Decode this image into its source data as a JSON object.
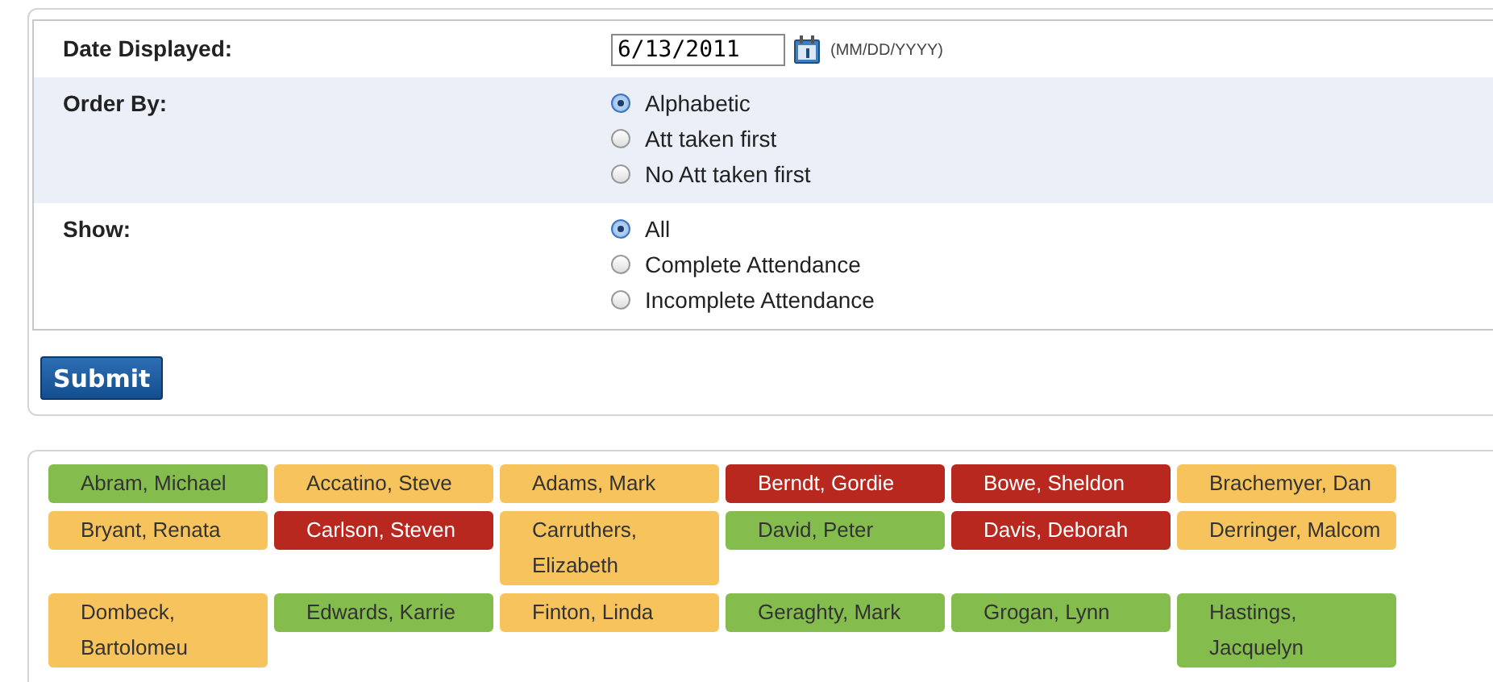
{
  "filters": {
    "date": {
      "label": "Date Displayed:",
      "value": "6/13/2011",
      "format_hint": "(MM/DD/YYYY)"
    },
    "order_by": {
      "label": "Order By:",
      "options": [
        {
          "label": "Alphabetic",
          "selected": true
        },
        {
          "label": "Att taken first",
          "selected": false
        },
        {
          "label": "No Att taken first",
          "selected": false
        }
      ]
    },
    "show": {
      "label": "Show:",
      "options": [
        {
          "label": "All",
          "selected": true
        },
        {
          "label": "Complete Attendance",
          "selected": false
        },
        {
          "label": "Incomplete Attendance",
          "selected": false
        }
      ]
    },
    "submit": "Submit"
  },
  "students": [
    {
      "name": "Abram, Michael",
      "color": "#84bd4e"
    },
    {
      "name": "Accatino, Steve",
      "color": "#f7c35c"
    },
    {
      "name": "Adams, Mark",
      "color": "#f7c35c"
    },
    {
      "name": "Berndt, Gordie",
      "color": "#b8281f"
    },
    {
      "name": "Bowe, Sheldon",
      "color": "#b8281f"
    },
    {
      "name": "Brachemyer, Dan",
      "color": "#f7c35c"
    },
    {
      "name": "Bryant, Renata",
      "color": "#f7c35c"
    },
    {
      "name": "Carlson, Steven",
      "color": "#b8281f"
    },
    {
      "name": "Carruthers, Elizabeth",
      "color": "#f7c35c"
    },
    {
      "name": "David, Peter",
      "color": "#84bd4e"
    },
    {
      "name": "Davis, Deborah",
      "color": "#b8281f"
    },
    {
      "name": "Derringer, Malcom",
      "color": "#f7c35c"
    },
    {
      "name": "Dombeck, Bartolomeu",
      "color": "#f7c35c"
    },
    {
      "name": "Edwards, Karrie",
      "color": "#84bd4e"
    },
    {
      "name": "Finton, Linda",
      "color": "#f7c35c"
    },
    {
      "name": "Geraghty, Mark",
      "color": "#84bd4e"
    },
    {
      "name": "Grogan, Lynn",
      "color": "#84bd4e"
    },
    {
      "name": "Hastings, Jacquelyn",
      "color": "#84bd4e"
    }
  ]
}
